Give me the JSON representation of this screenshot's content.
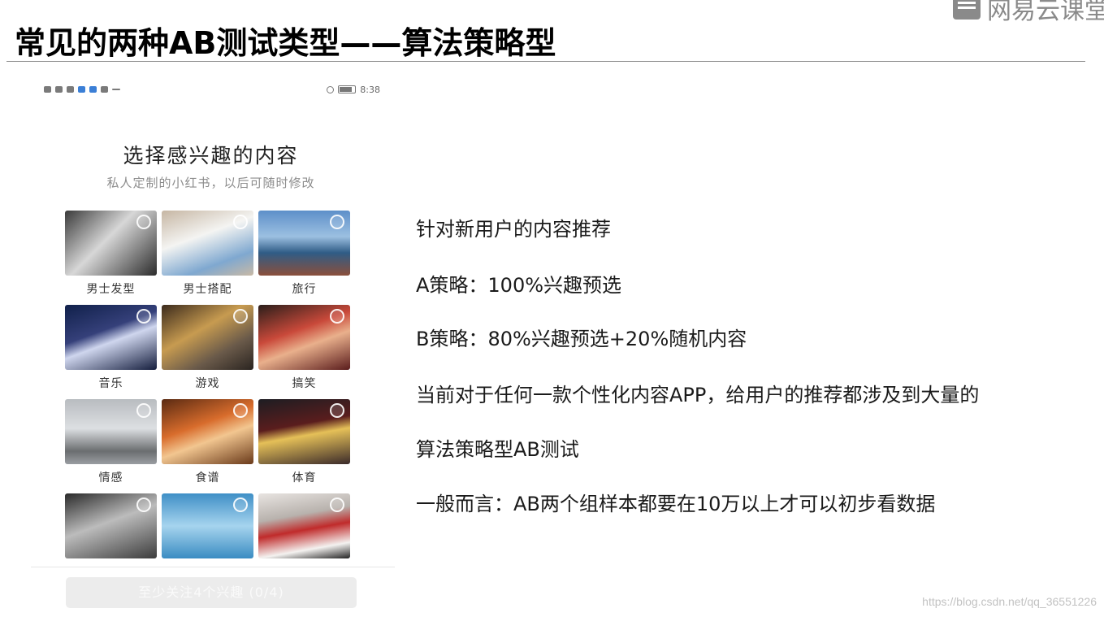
{
  "slide": {
    "title": "常见的两种AB测试类型——算法策略型",
    "brand": "网易云课堂"
  },
  "phone": {
    "status": {
      "time": "8:38"
    },
    "title": "选择感兴趣的内容",
    "subtitle": "私人定制的小红书，以后可随时修改",
    "tiles": [
      {
        "label": "男士发型"
      },
      {
        "label": "男士搭配"
      },
      {
        "label": "旅行"
      },
      {
        "label": "音乐"
      },
      {
        "label": "游戏"
      },
      {
        "label": "搞笑"
      },
      {
        "label": "情感"
      },
      {
        "label": "食谱"
      },
      {
        "label": "体育"
      },
      {
        "label": ""
      },
      {
        "label": ""
      },
      {
        "label": ""
      }
    ],
    "cta": "至少关注4个兴趣 (0/4)"
  },
  "points": [
    "针对新用户的内容推荐",
    "A策略：100%兴趣预选",
    "B策略：80%兴趣预选+20%随机内容",
    "当前对于任何一款个性化内容APP，给用户的推荐都涉及到大量的",
    "算法策略型AB测试",
    "一般而言：AB两个组样本都要在10万以上才可以初步看数据"
  ],
  "watermark": "https://blog.csdn.net/qq_36551226"
}
